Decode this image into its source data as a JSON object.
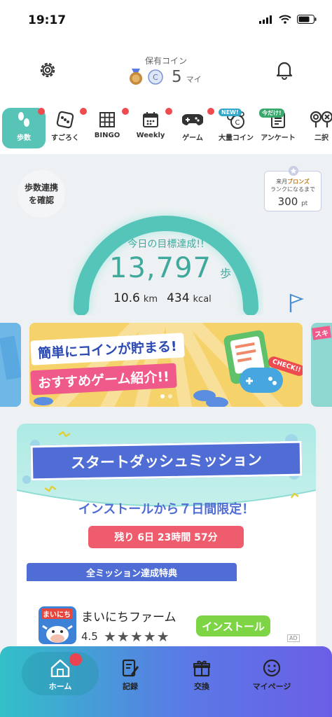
{
  "status_bar": {
    "time": "19:17"
  },
  "header": {
    "coin_label": "保有コイン",
    "coin_value": "5",
    "coin_unit": "マイ"
  },
  "categories": [
    {
      "label": "歩数",
      "icon": "footprints-icon"
    },
    {
      "label": "すごろく",
      "icon": "dice-icon"
    },
    {
      "label": "BINGO",
      "icon": "bingo-grid-icon"
    },
    {
      "label": "Weekly",
      "icon": "calendar-icon"
    },
    {
      "label": "ゲーム",
      "icon": "gamepad-icon"
    },
    {
      "label": "大量コイン",
      "icon": "coins-icon",
      "tag": "NEW!"
    },
    {
      "label": "アンケート",
      "icon": "survey-icon",
      "tag": "今だけ!"
    },
    {
      "label": "二択",
      "icon": "binary-choice-icon"
    }
  ],
  "steps": {
    "sync_button_label": "歩数連携を確認",
    "rank_card": {
      "line1_prefix": "来月",
      "rank_name": "ブロンズ",
      "line2": "ランクになるまで",
      "points": "300",
      "points_unit": "pt"
    },
    "goal_caption": "今日の目標達成!!",
    "step_count": "13,797",
    "step_unit": "歩",
    "distance": "10.6",
    "distance_unit": "km",
    "calories": "434",
    "calories_unit": "kcal",
    "progress_fraction": 1.0
  },
  "banner": {
    "line1": "簡単にコインが貯まる!",
    "line2": "おすすめゲーム紹介!!",
    "badge": "CHECK!!",
    "peek_right_text": "スキ"
  },
  "mission": {
    "title": "スタートダッシュミッション",
    "limit_text": "インストールから７日間限定！",
    "remaining": "残り 6日 23時間 57分",
    "reward_header": "全ミッション達成特典"
  },
  "ad": {
    "icon_text": "まいにち",
    "app_name": "まいにちファーム",
    "rating": "4.5",
    "stars": "★★★★★",
    "install_label": "インストール",
    "ad_mark": "AD"
  },
  "bottom_nav": [
    {
      "label": "ホーム",
      "icon": "home-icon"
    },
    {
      "label": "記録",
      "icon": "record-icon"
    },
    {
      "label": "交換",
      "icon": "gift-icon"
    },
    {
      "label": "マイページ",
      "icon": "smiley-icon"
    }
  ],
  "colors": {
    "accent": "#58c4b8",
    "primary_blue": "#4f6dd4",
    "alert_red": "#ee4b50"
  }
}
